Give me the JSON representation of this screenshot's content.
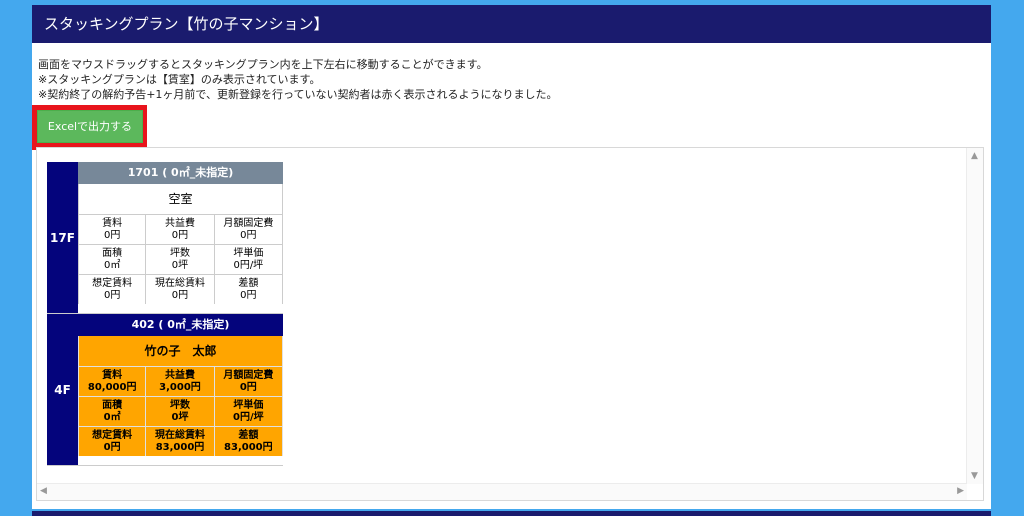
{
  "header": {
    "title": "スタッキングプラン【竹の子マンション】"
  },
  "notes": [
    "画面をマウスドラッグするとスタッキングプラン内を上下左右に移動することができます。",
    "※スタッキングプランは【賃室】のみ表示されています。",
    "※契約終了の解約予告+1ヶ月前で、更新登録を行っていない契約者は赤く表示されるようになりました。"
  ],
  "export_button": {
    "label": "Excelで出力する"
  },
  "floors": [
    {
      "label": "17F",
      "unit": {
        "title": "1701 ( 0㎡_未指定)",
        "tenant": "空室",
        "fields": [
          {
            "name": "賃料",
            "value": "0円"
          },
          {
            "name": "共益費",
            "value": "0円"
          },
          {
            "name": "月額固定費",
            "value": "0円"
          },
          {
            "name": "面積",
            "value": "0㎡"
          },
          {
            "name": "坪数",
            "value": "0坪"
          },
          {
            "name": "坪単価",
            "value": "0円/坪"
          },
          {
            "name": "想定賃料",
            "value": "0円"
          },
          {
            "name": "現在総賃料",
            "value": "0円"
          },
          {
            "name": "差額",
            "value": "0円"
          }
        ]
      }
    },
    {
      "label": "4F",
      "unit": {
        "title": "402 ( 0㎡_未指定)",
        "tenant": "竹の子　太郎",
        "fields": [
          {
            "name": "賃料",
            "value": "80,000円"
          },
          {
            "name": "共益費",
            "value": "3,000円"
          },
          {
            "name": "月額固定費",
            "value": "0円"
          },
          {
            "name": "面積",
            "value": "0㎡"
          },
          {
            "name": "坪数",
            "value": "0坪"
          },
          {
            "name": "坪単価",
            "value": "0円/坪"
          },
          {
            "name": "想定賃料",
            "value": "0円"
          },
          {
            "name": "現在総賃料",
            "value": "83,000円"
          },
          {
            "name": "差額",
            "value": "83,000円"
          }
        ]
      }
    }
  ],
  "colors": {
    "header": "#1a1b6e",
    "page_bg": "#44a8ee",
    "floor_label": "#04047c",
    "vacant_title": "#778899",
    "occupied": "#ffa500",
    "export_button": "#5cb85c",
    "highlight_outline": "#e8141c"
  },
  "icons": {
    "scroll_up": "▲",
    "scroll_down": "▼",
    "scroll_left": "◀",
    "scroll_right": "▶"
  }
}
